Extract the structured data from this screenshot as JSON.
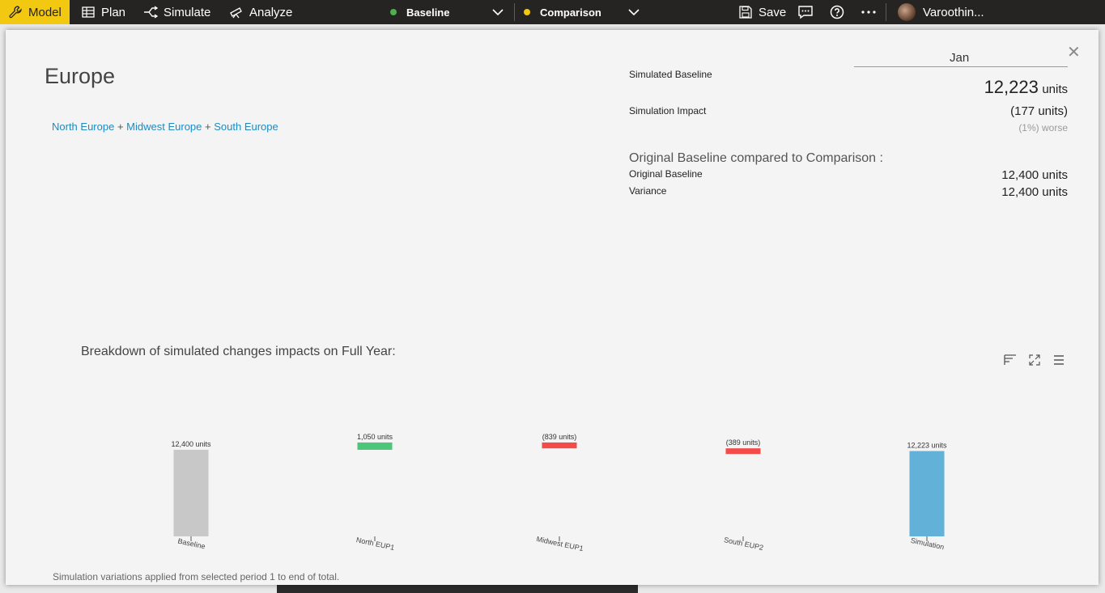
{
  "topbar": {
    "model_label": "Model",
    "plan_label": "Plan",
    "simulate_label": "Simulate",
    "analyze_label": "Analyze",
    "baseline_label": "Baseline",
    "comparison_label": "Comparison",
    "save_label": "Save",
    "user_name": "Varoothin...",
    "colors": {
      "accent": "#f2c811",
      "baseline_dot": "#4caf50",
      "comparison_dot": "#f2c811"
    }
  },
  "dialog": {
    "region_title": "Europe",
    "region_links": [
      "North Europe",
      "Midwest Europe",
      "South Europe"
    ],
    "link_separator": "+",
    "month": "Jan",
    "simulated_baseline_label": "Simulated Baseline",
    "simulated_baseline_value": "12,223",
    "simulated_baseline_unit": "units",
    "simulation_impact_label": "Simulation Impact",
    "simulation_impact_value": "(177 units)",
    "simulation_impact_note": "(1%) worse",
    "compare_heading": "Original Baseline compared to Comparison :",
    "original_baseline_label": "Original Baseline",
    "original_baseline_value": "12,400 units",
    "variance_label": "Variance",
    "variance_value": "12,400 units",
    "breakdown_title": "Breakdown of simulated changes impacts on Full Year:",
    "footnote": "Simulation variations applied from selected period 1 to end of total."
  },
  "chart_data": {
    "type": "bar",
    "subtype": "waterfall",
    "categories": [
      "Baseline",
      "North EUP1",
      "Midwest EUP1",
      "South EUP2",
      "Simulation"
    ],
    "values": [
      12400,
      1050,
      -839,
      -389,
      12223
    ],
    "data_labels": [
      "12,400 units",
      "1,050 units",
      "(839 units)",
      "(389 units)",
      "12,223 units"
    ],
    "colors": [
      "#c8c8c8",
      "#4cc77a",
      "#f44a4a",
      "#f44a4a",
      "#61b1d9"
    ]
  }
}
